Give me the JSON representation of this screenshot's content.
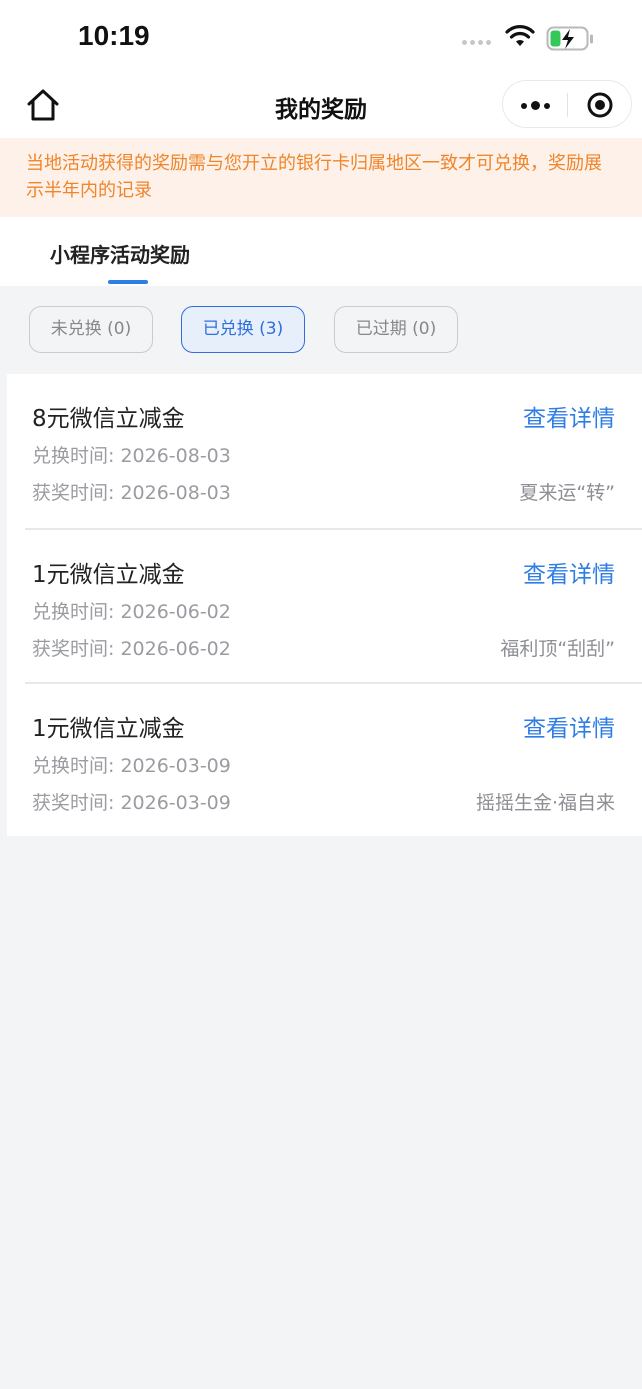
{
  "status_bar": {
    "time": "10:19"
  },
  "nav": {
    "title": "我的奖励"
  },
  "notice": "当地活动获得的奖励需与您开立的银行卡归属地区一致才可兑换，奖励展示半年内的记录",
  "tabs": [
    {
      "label": "小程序活动奖励",
      "active": true
    }
  ],
  "filters": [
    {
      "label": "未兑换 (0)",
      "active": false
    },
    {
      "label": "已兑换 (3)",
      "active": true
    },
    {
      "label": "已过期 (0)",
      "active": false
    }
  ],
  "rewards": [
    {
      "title": "8元微信立减金",
      "link": "查看详情",
      "exchange_time": "兑换时间: 2026-08-03",
      "award_time": "获奖时间: 2026-08-03",
      "source": "夏来运“转”"
    },
    {
      "title": "1元微信立减金",
      "link": "查看详情",
      "exchange_time": "兑换时间: 2026-06-02",
      "award_time": "获奖时间: 2026-06-02",
      "source": "福利顶“刮刮”"
    },
    {
      "title": "1元微信立减金",
      "link": "查看详情",
      "exchange_time": "兑换时间: 2026-03-09",
      "award_time": "获奖时间: 2026-03-09",
      "source": "摇摇生金·福自来"
    }
  ],
  "colors": {
    "accent": "#2f7ee6",
    "notice_text": "#f0852a",
    "notice_bg": "#fdf1e9",
    "page_bg": "#f3f4f6"
  },
  "icons": {
    "home": "home-icon",
    "more": "more-dots-icon",
    "close": "target-circle-icon",
    "wifi": "wifi-icon",
    "battery": "battery-charging-icon"
  }
}
